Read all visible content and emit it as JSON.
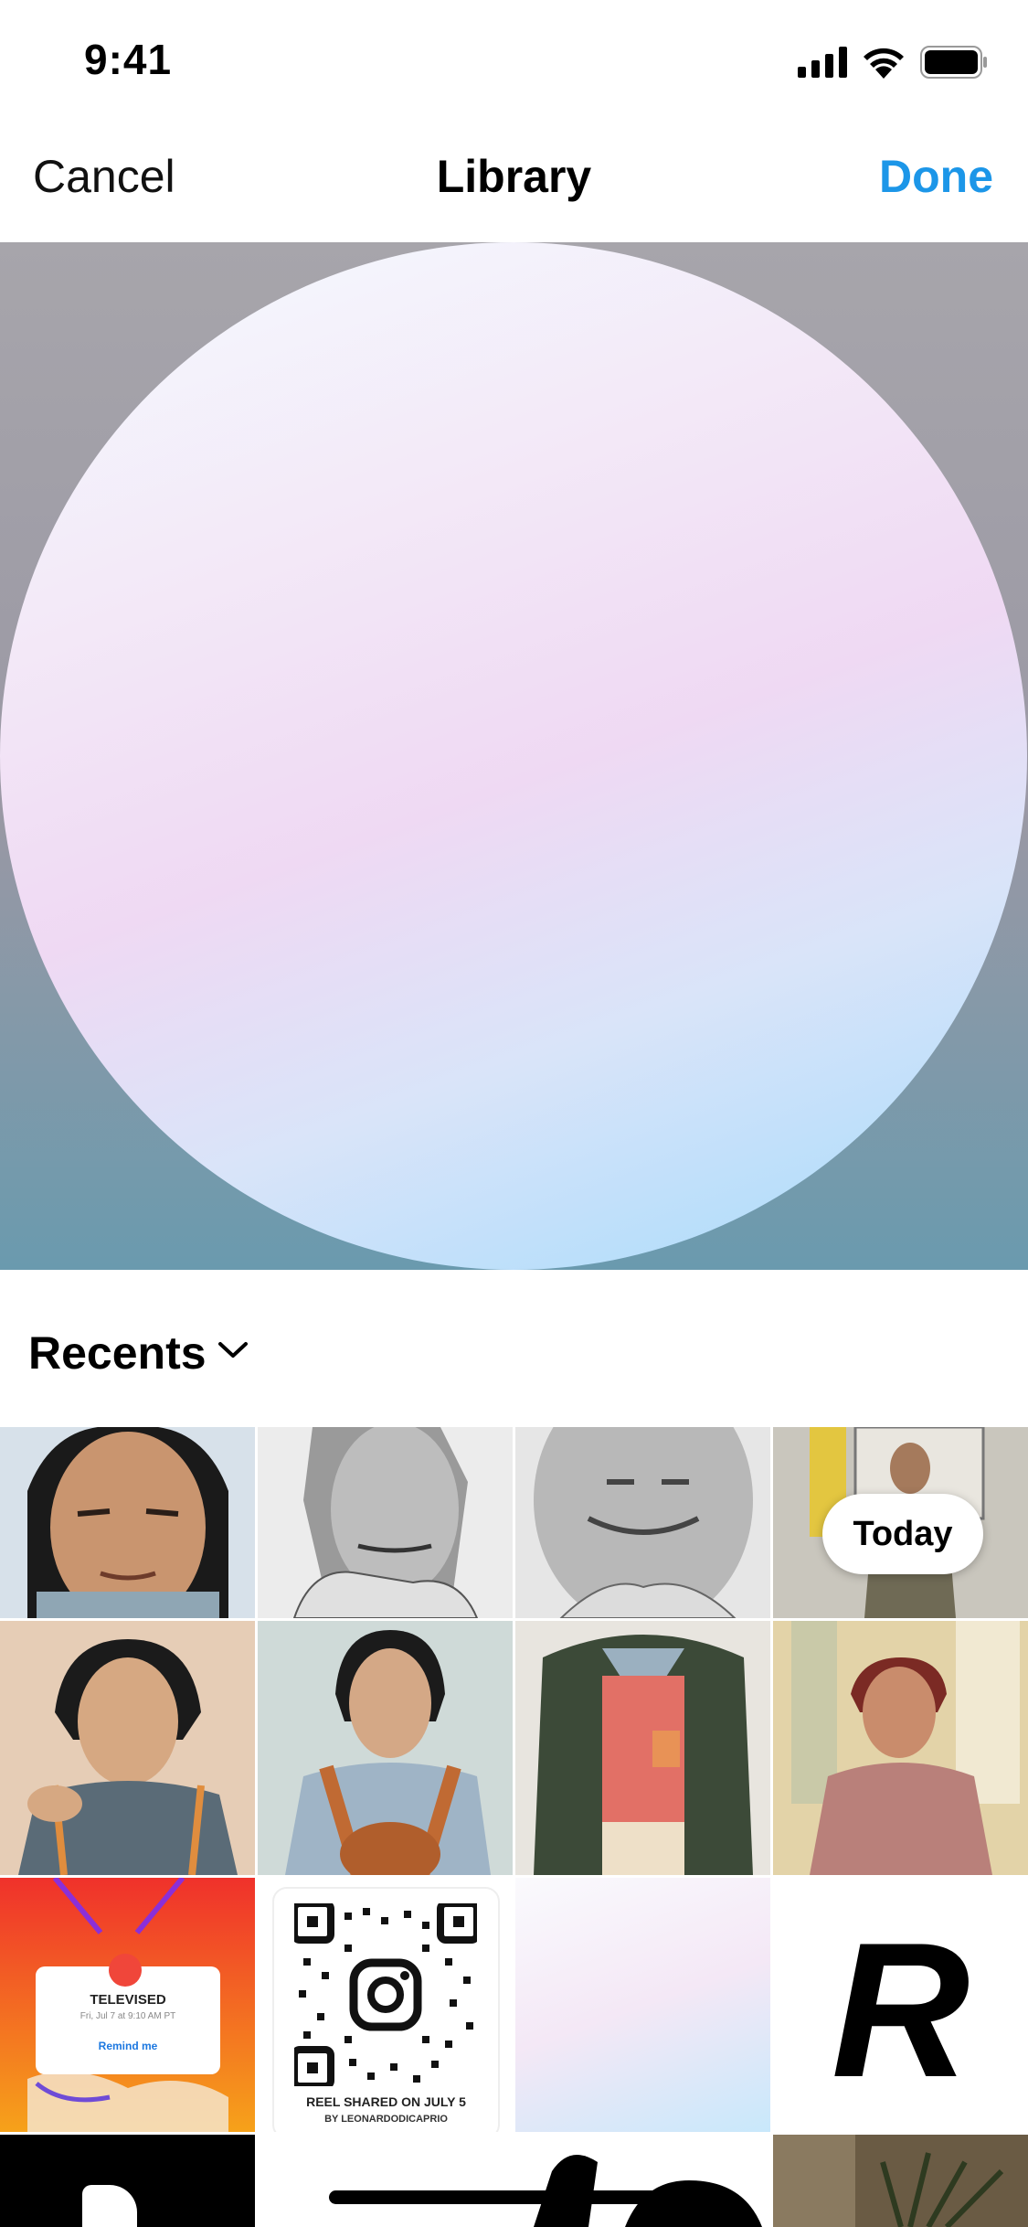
{
  "status": {
    "time": "9:41"
  },
  "nav": {
    "cancel": "Cancel",
    "title": "Library",
    "done": "Done"
  },
  "recents": {
    "label": "Recents"
  },
  "grid": {
    "today_label": "Today",
    "televised_card": {
      "title": "TELEVISED",
      "subtitle": "Fri, Jul 7 at 9:10 AM PT",
      "action": "Remind me"
    },
    "qr_card": {
      "line1": "REEL SHARED ON JULY 5",
      "line2": "BY LEONARDODICAPRIO"
    },
    "letter_tile": "R"
  },
  "colors": {
    "accent": "#1c96e8"
  },
  "icons": [
    "signal-icon",
    "wifi-icon",
    "battery-icon",
    "chevron-down-icon",
    "instagram-icon"
  ]
}
